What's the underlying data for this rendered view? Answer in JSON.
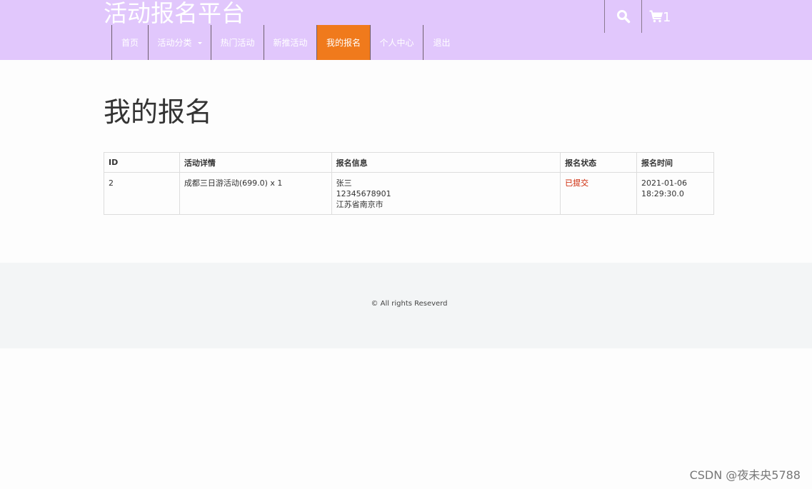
{
  "header": {
    "site_title": "活动报名平台",
    "cart_count": "1",
    "search_icon": "search-icon",
    "cart_icon": "cart-icon"
  },
  "nav": {
    "items": [
      {
        "label": "首页",
        "active": false
      },
      {
        "label": "活动分类",
        "active": false,
        "dropdown": true
      },
      {
        "label": "热门活动",
        "active": false
      },
      {
        "label": "新推活动",
        "active": false
      },
      {
        "label": "我的报名",
        "active": true
      },
      {
        "label": "个人中心",
        "active": false
      },
      {
        "label": "退出",
        "active": false
      }
    ]
  },
  "main": {
    "title": "我的报名",
    "table": {
      "headers": [
        "ID",
        "活动详情",
        "报名信息",
        "报名状态",
        "报名时间"
      ],
      "rows": [
        {
          "id": "2",
          "detail": "成都三日游活动(699.0) x 1",
          "info_name": "张三",
          "info_phone": "12345678901",
          "info_address": "江苏省南京市",
          "status": "已提交",
          "time_date": "2021-01-06",
          "time_clock": "18:29:30.0"
        }
      ]
    }
  },
  "footer": {
    "copyright": "© All rights Reseverd"
  },
  "watermark": "CSDN @夜未央5788",
  "colors": {
    "header_bg": "#e1c7fc",
    "active_nav": "#f07a1c",
    "status_submitted": "#cc2200",
    "footer_bg": "#f3f5f6"
  }
}
